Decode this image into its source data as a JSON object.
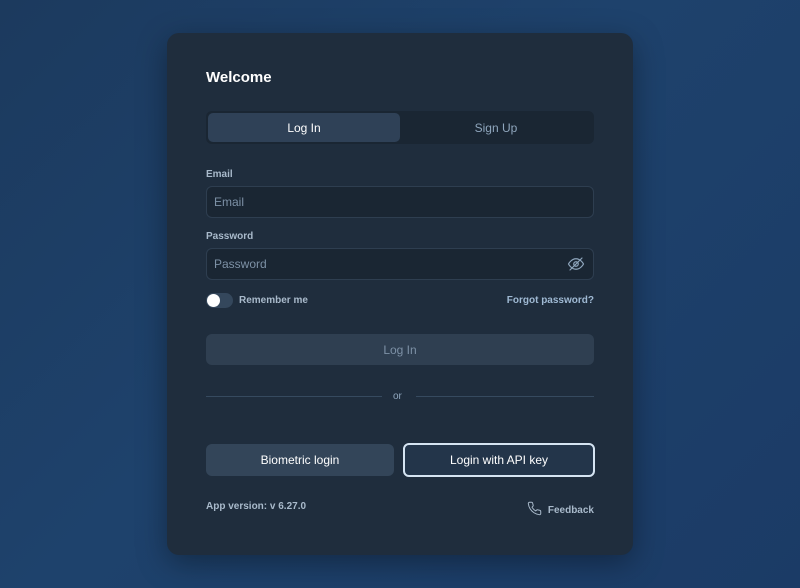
{
  "form": {
    "title": "Welcome",
    "tabs": [
      {
        "label": "Log In",
        "active": true
      },
      {
        "label": "Sign Up",
        "active": false
      }
    ],
    "email": {
      "label": "Email",
      "placeholder": "Email",
      "value": ""
    },
    "password": {
      "label": "Password",
      "placeholder": "Password",
      "value": "",
      "toggle_icon": "eye-slash-icon"
    },
    "remember": {
      "label": "Remember me",
      "checked": false
    },
    "forgot_label": "Forgot password?",
    "login_label": "Log In",
    "divider_label": "or",
    "biometric_label": "Biometric login",
    "api_key_label": "Login with API key"
  },
  "footer": {
    "version": "App version: v 6.27.0",
    "feedback_label": "Feedback",
    "feedback_icon": "phone-icon"
  },
  "colors": {
    "card": "#1f2d3d",
    "accent_border": "#d5e4f2",
    "background": "#1e426c"
  }
}
